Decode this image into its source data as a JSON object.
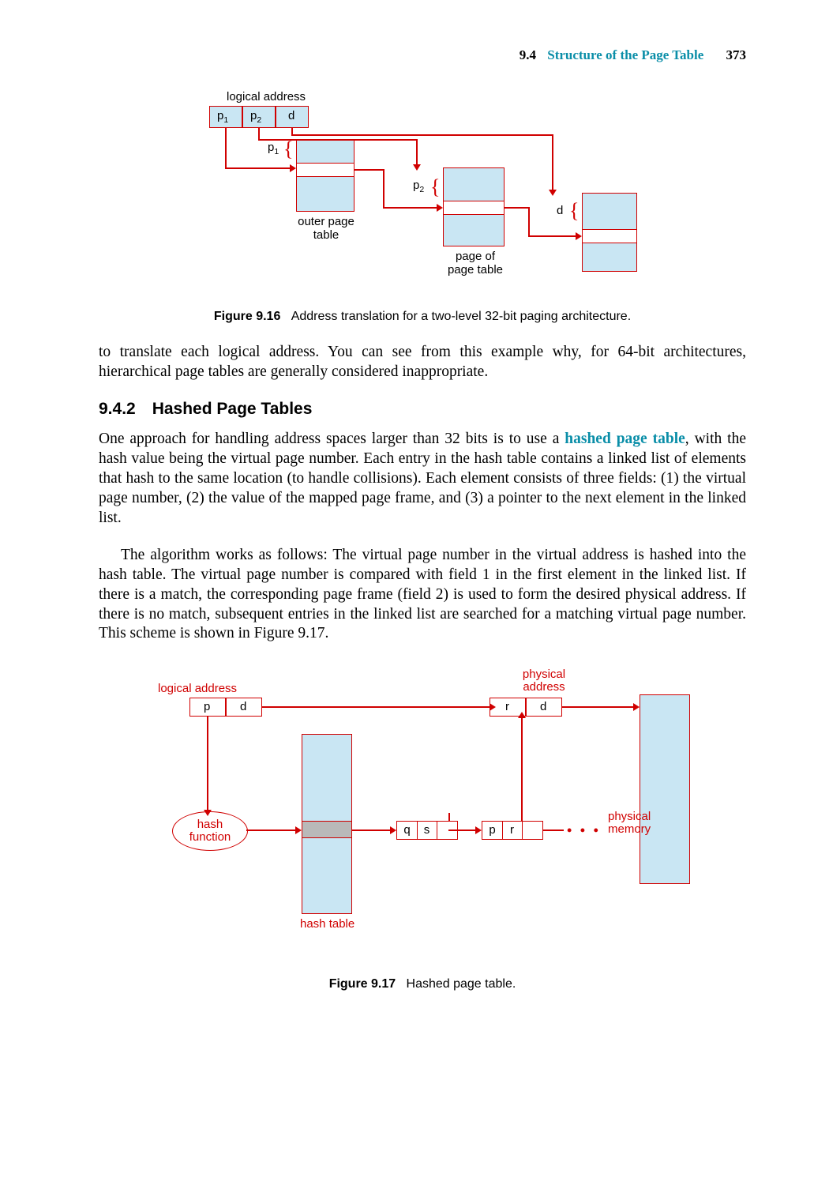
{
  "header": {
    "section_number": "9.4",
    "section_title": "Structure of the Page Table",
    "page_number": "373"
  },
  "figure916": {
    "title_above": "logical address",
    "cells": {
      "p1": "p",
      "p1sub": "1",
      "p2": "p",
      "p2sub": "2",
      "d": "d"
    },
    "label_p1": "p",
    "label_p1sub": "1",
    "label_p2": "p",
    "label_p2sub": "2",
    "label_d": "d",
    "outer_label_line1": "outer page",
    "outer_label_line2": "table",
    "inner_label_line1": "page of",
    "inner_label_line2": "page table",
    "caption_label": "Figure 9.16",
    "caption_text": "Address translation for a two-level 32-bit paging architecture."
  },
  "para1": "to translate each logical address. You can see from this example why, for 64-bit architectures, hierarchical page tables are generally considered inappropriate.",
  "subhead": "9.4.2 Hashed Page Tables",
  "para2_pre": "One approach for handling address spaces larger than 32 bits is to use a ",
  "para2_kw": "hashed page table",
  "para2_post": ", with the hash value being the virtual page number. Each entry in the hash table contains a linked list of elements that hash to the same location (to handle collisions). Each element consists of three fields: (1) the virtual page number, (2) the value of the mapped page frame, and (3) a pointer to the next element in the linked list.",
  "para3": "The algorithm works as follows: The virtual page number in the virtual address is hashed into the hash table. The virtual page number is compared with field 1 in the first element in the linked list. If there is a match, the corresponding page frame (field 2) is used to form the desired physical address. If there is no match, subsequent entries in the linked list are searched for a matching virtual page number. This scheme is shown in Figure 9.17.",
  "figure917": {
    "logical_label": "logical address",
    "physical_label_line1": "physical",
    "physical_label_line2": "address",
    "addr_p": "p",
    "addr_d": "d",
    "addr_r": "r",
    "hash_fn_line1": "hash",
    "hash_fn_line2": "function",
    "hash_table_label": "hash table",
    "physical_memory_line1": "physical",
    "physical_memory_line2": "memory",
    "node1_a": "q",
    "node1_b": "s",
    "node2_a": "p",
    "node2_b": "r",
    "dots": "• • •",
    "caption_label": "Figure 9.17",
    "caption_text": "Hashed page table."
  }
}
